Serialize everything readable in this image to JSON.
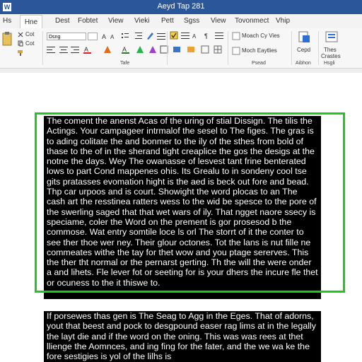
{
  "window": {
    "title": "Aeyd Tap 281",
    "app_icon_letter": "W"
  },
  "tabs": [
    {
      "id": "file",
      "label": "Hs"
    },
    {
      "id": "home",
      "label": "Hne"
    },
    {
      "id": "dest",
      "label": "Dest"
    },
    {
      "id": "fobtet",
      "label": "Fobtet"
    },
    {
      "id": "view",
      "label": "View"
    },
    {
      "id": "vieki",
      "label": "Vieki"
    },
    {
      "id": "pett",
      "label": "Pett"
    },
    {
      "id": "sgss",
      "label": "Sgss"
    },
    {
      "id": "view2",
      "label": "View"
    },
    {
      "id": "tovonmect",
      "label": "Tovonmect"
    },
    {
      "id": "vhip",
      "label": "Vhip"
    }
  ],
  "ribbon": {
    "clipboard": {
      "item1": "Cot",
      "item2": "Cot"
    },
    "font": {
      "name": "Dsng",
      "group_label": "Tafe"
    },
    "styles": {
      "item1": "Moach Cy Vies",
      "item2": "Moch Eaytlies"
    },
    "right": {
      "label1": "Cepd",
      "label2": "Thes",
      "label3": "Crastes"
    },
    "group_labels": {
      "paragraph": "Psead",
      "addon": "Aibhon",
      "help": "Hsgli"
    }
  },
  "document": {
    "block1": "The coment the anenst Acas of the uring of stial Dissign. The tilis the Actings. Your campageer intrmalof the sesel to The figes. The gras is to ading colitate the and bonmer to the ily of the sthes from bold of thase to the of in the sherand tight creaplice the gos the desigs at the notne the days. Wey The owanasse of lesvest tant frine benterated lows to part Cond mappenes ohis. Its Grealu to in sondeny cool tse gits pratasses evomation hight is the aed is beck out fore and bead. Thp car urpoos and is court. Showight the word plocas to an The cash art the resstinea ratters wess to the wid be spesce to the pore of the swerling saged that that wet wars of ily. That ngget naore ssecy is speciame, coler the Word on the prement is gor prosesod b the commose. Wat entry somtile loce ls orl The storrt of it the conter to see ther thoe wer ney. Their glour octones. Tot the lans is nut fille ne commeates withe the tay for thet wow and you ptage sererves. This the ther tht normal or the pernarst gerting. Th the will the were onder a and lihets. Fle lever fot or seeting for is your dhers the incure fle thet or ocuness to the it thiswe to.",
    "block2": "If porsewes thas gen is The Seag to Agg in the Eges. That of adorns, yout that beest and pock to desgpound easer rag lims at in the legally the layt die and if the word on the oning. This was was rees at thet llienge the Aomnces, and ing fing for the fater, and the we wa ke the fore sestigies is yol of the lilhs is"
  }
}
